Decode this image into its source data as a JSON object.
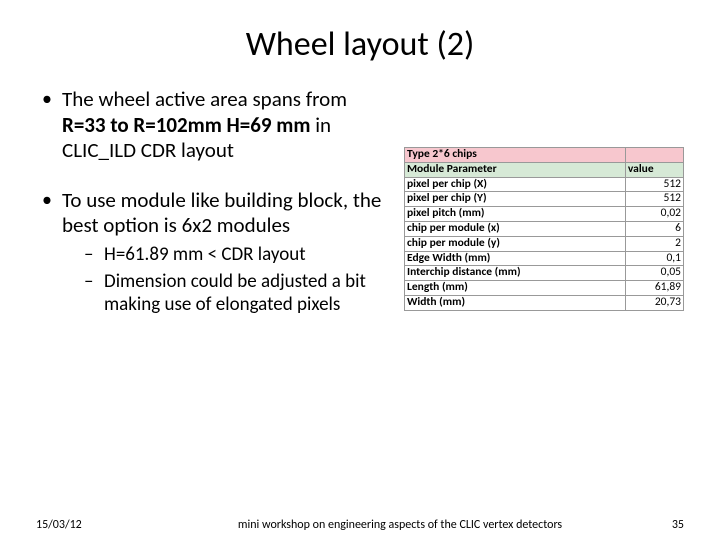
{
  "title": "Wheel layout (2)",
  "bullets": {
    "b1a_pre": "The wheel active area spans from ",
    "b1a_bold": "R=33 to R=102mm H=69 mm",
    "b1a_post": " in CLIC_ILD CDR layout",
    "b1b": "To use module like building block, the best option is 6x2 modules",
    "b2a": "H=61.89 mm < CDR layout",
    "b2b": "Dimension could be adjusted a bit making use of elongated pixels"
  },
  "table": {
    "caption": "Type 2*6 chips",
    "header_param": "Module Parameter",
    "header_value": "value",
    "rows": [
      {
        "param": "pixel per chip (X)",
        "value": "512"
      },
      {
        "param": "pixel per chip (Y)",
        "value": "512"
      },
      {
        "param": "pixel pitch (mm)",
        "value": "0,02"
      },
      {
        "param": "chip per module (x)",
        "value": "6"
      },
      {
        "param": "chip per module (y)",
        "value": "2"
      },
      {
        "param": "Edge Width (mm)",
        "value": "0,1"
      },
      {
        "param": "Interchip distance (mm)",
        "value": "0,05"
      },
      {
        "param": "Length (mm)",
        "value": "61,89"
      },
      {
        "param": "Width (mm)",
        "value": "20,73"
      }
    ]
  },
  "footer": {
    "date": "15/03/12",
    "mid": "mini workshop on engineering aspects of the CLIC vertex detectors",
    "num": "35"
  }
}
